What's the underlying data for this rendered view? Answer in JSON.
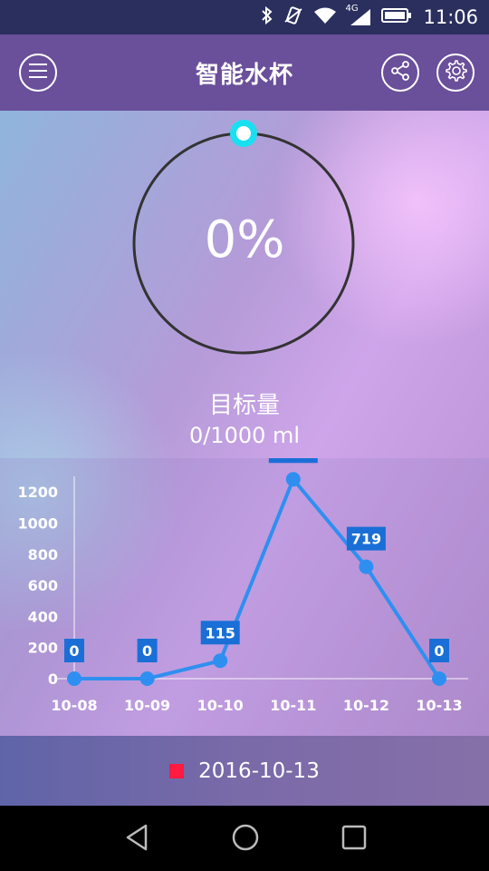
{
  "status_bar": {
    "network": "4G",
    "time": "11:06"
  },
  "app_bar": {
    "title": "智能水杯"
  },
  "progress": {
    "percent_text": "0%",
    "percent": 0,
    "ring_color": "#333333",
    "knob_color": "#19e0f0"
  },
  "target": {
    "label": "目标量",
    "value": "0/1000 ml"
  },
  "chart_data": {
    "type": "line",
    "categories": [
      "10-08",
      "10-09",
      "10-10",
      "10-11",
      "10-12",
      "10-13"
    ],
    "values": [
      0,
      0,
      115,
      1281,
      719,
      0
    ],
    "y_ticks": [
      0,
      200,
      400,
      600,
      800,
      1000,
      1200
    ],
    "ylim": [
      0,
      1300
    ],
    "line_color": "#2f8ff0",
    "label_bg_color": "#1a6fd6",
    "grid": false
  },
  "legend": {
    "label": "2016-10-13",
    "color": "#ff1a40"
  },
  "nav_bar": {
    "back_icon": "back-icon",
    "home_icon": "home-icon",
    "recents_icon": "recents-icon"
  }
}
